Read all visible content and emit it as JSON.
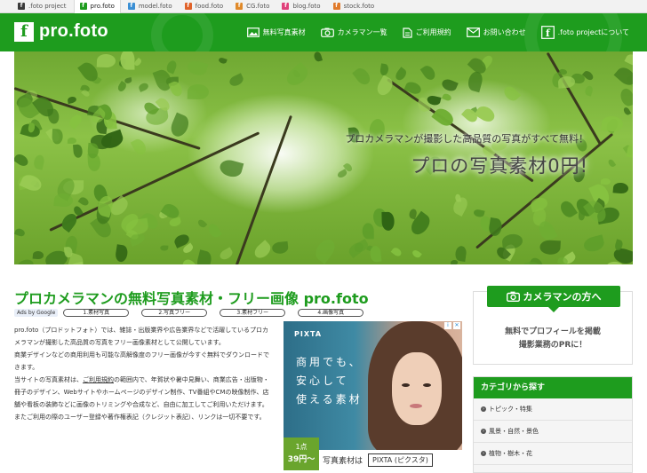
{
  "tabs": [
    {
      "label": ".foto project",
      "color": "#3a3a3a",
      "active": false
    },
    {
      "label": "pro.foto",
      "color": "#1e9c1e",
      "active": true
    },
    {
      "label": "model.foto",
      "color": "#3b8fd4",
      "active": false
    },
    {
      "label": "food.foto",
      "color": "#e0632a",
      "active": false
    },
    {
      "label": "CG.foto",
      "color": "#e08a2a",
      "active": false
    },
    {
      "label": "blog.foto",
      "color": "#e0407a",
      "active": false
    },
    {
      "label": "stock.foto",
      "color": "#e07a2a",
      "active": false
    }
  ],
  "header": {
    "logo_mark": "f",
    "logo_text": "pro.foto",
    "nav": [
      {
        "label": "無料写真素材",
        "icon": "image-icon"
      },
      {
        "label": "カメラマン一覧",
        "icon": "camera-icon"
      },
      {
        "label": "ご利用規約",
        "icon": "document-icon"
      },
      {
        "label": "お問い合わせ",
        "icon": "mail-icon"
      },
      {
        "label": ".foto projectについて",
        "icon": "foto-logo-icon"
      }
    ]
  },
  "hero": {
    "subtitle": "プロカメラマンが撮影した高品質の写真がすべて無料！",
    "title": "プロの写真素材0円!"
  },
  "main": {
    "title": "プロカメラマンの無料写真素材・フリー画像 pro.foto",
    "ads_label": "Ads by Google",
    "ad_links": [
      "1.素材写真",
      "2.写真フリー",
      "3.素材フリー",
      "4.画像写真"
    ],
    "paragraph1_a": "pro.foto（プロドットフォト）では、雑誌・出版業界や広告業界などで活躍しているプロカメラマンが撮影した高品質の写真をフリー画像素材として公開しています。",
    "paragraph2": "商業デザインなどの商用利用も可能な高解像度のフリー画像が今すぐ無料でダウンロードできます。",
    "paragraph3_a": "当サイトの写真素材は、",
    "paragraph3_link": "ご利用規約",
    "paragraph3_b": "の範囲内で、年賀状や暑中見舞い、商業広告・出版物・冊子のデザイン、Webサイトやホームページのデザイン制作、TV番組やCMの映像制作、店舗や看板の装飾などに画像のトリミングや合成など、自由に加工してご利用いただけます。またご利用の際のユーザー登録や著作権表記（クレジット表記）、リンクは一切不要です。"
  },
  "pixta_ad": {
    "brand": "PIXTA",
    "copy_lines": [
      "商用でも、",
      "安心して",
      "使える素材"
    ],
    "price_line1": "1点",
    "price_value": "39円〜",
    "strip_label": "写真素材は",
    "strip_brand": "PIXTA (ピクスタ)"
  },
  "sidebar": {
    "camera_button": "カメラマンの方へ",
    "camera_sub_line1": "無料でプロフィールを掲載",
    "camera_sub_line2": "撮影業務のPRに！",
    "category_head": "カテゴリから探す",
    "categories": [
      "トピック・特集",
      "風景・自然・景色",
      "植物・樹木・花"
    ]
  },
  "colors": {
    "brand_green": "#1e9c1e"
  }
}
